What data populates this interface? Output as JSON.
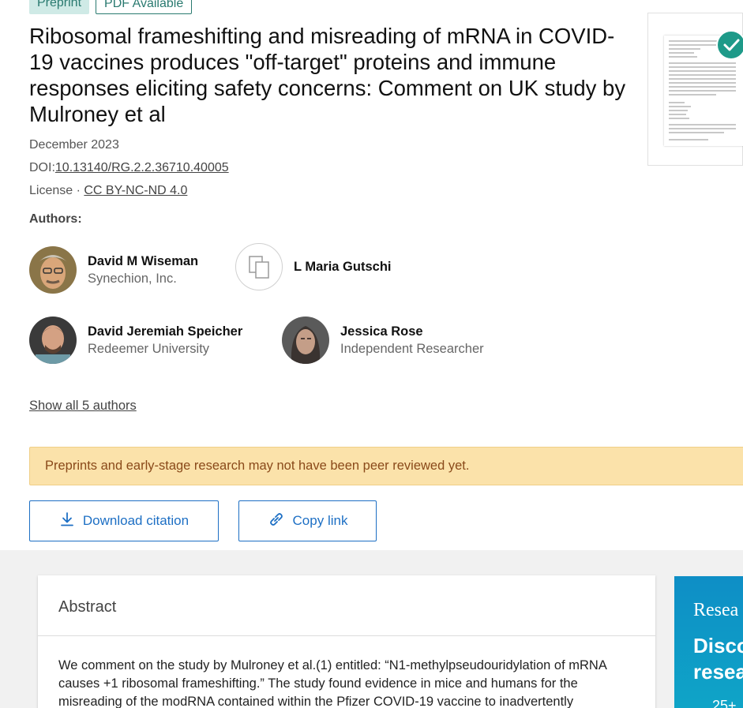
{
  "tags": {
    "preprint": "Preprint",
    "pdf": "PDF Available"
  },
  "title": "Ribosomal frameshifting and misreading of mRNA in COVID-19 vaccines produces \"off-target\" proteins and immune responses eliciting safety concerns: Comment on UK study by Mulroney et al",
  "date": "December 2023",
  "doi": {
    "label": "DOI:",
    "value": "10.13140/RG.2.2.36710.40005"
  },
  "license": {
    "label": "License · ",
    "value": "CC BY-NC-ND 4.0"
  },
  "authors_label": "Authors:",
  "authors": [
    {
      "name": "David M Wiseman",
      "affiliation": "Synechion, Inc."
    },
    {
      "name": "L Maria Gutschi",
      "affiliation": ""
    },
    {
      "name": "David Jeremiah Speicher",
      "affiliation": "Redeemer University"
    },
    {
      "name": "Jessica Rose",
      "affiliation": "Independent Researcher"
    }
  ],
  "show_all": "Show all 5 authors",
  "notice": "Preprints and early-stage research may not have been peer reviewed yet.",
  "buttons": {
    "download": "Download citation",
    "copy": "Copy link"
  },
  "abstract": {
    "title": "Abstract",
    "text": "We comment on the study by Mulroney et al.(1) entitled: “N1-methylpseudouridylation of mRNA causes +1 ribosomal frameshifting.” The study found evidence in mice and humans for the misreading of the modRNA contained within the Pfizer COVID-19 vaccine to inadvertently"
  },
  "promo": {
    "line1": "Resea",
    "line2a": "Disco",
    "line2b": "resea",
    "line3": "25+"
  },
  "colors": {
    "accent": "#1d6fc4",
    "teal": "#1e9a89",
    "notice_bg": "#fbe2aa",
    "notice_text": "#8a4a1a"
  }
}
